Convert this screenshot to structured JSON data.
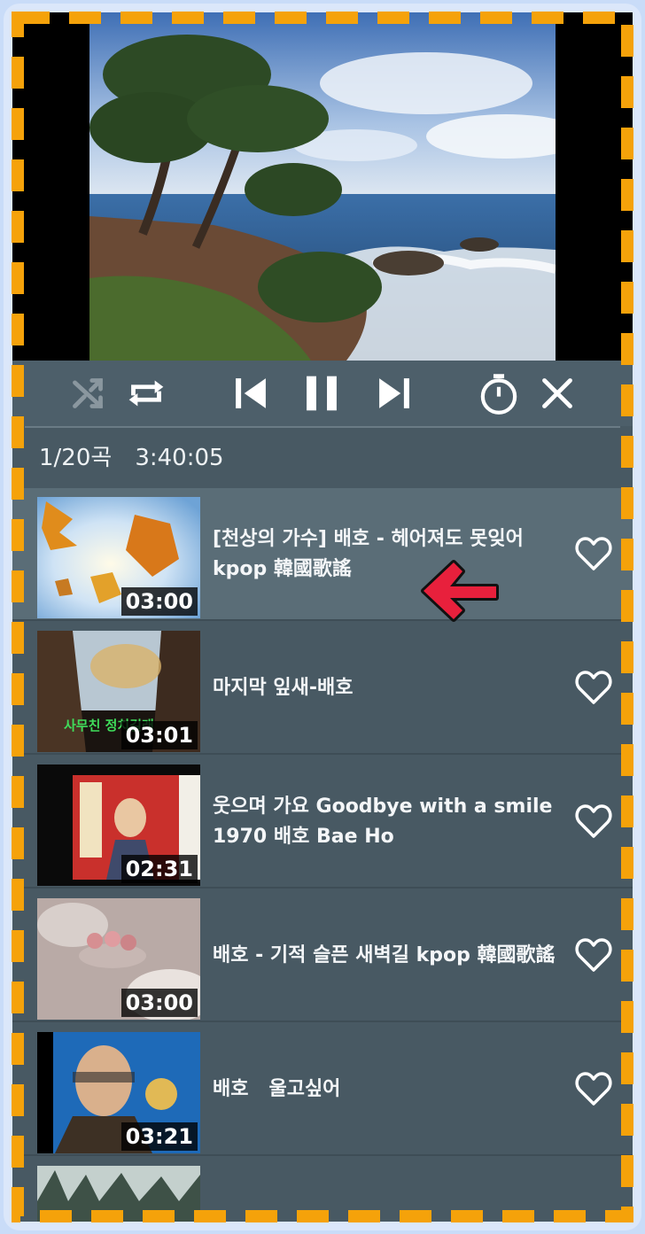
{
  "player": {
    "summary": {
      "track_count": "1/20곡",
      "total_time": "3:40:05"
    },
    "icons": {
      "shuffle": "shuffle-icon",
      "repeat": "repeat-icon",
      "previous": "skip-previous-icon",
      "pause": "pause-icon",
      "next": "skip-next-icon",
      "timer": "stopwatch-icon",
      "close": "close-icon",
      "favorite": "heart-outline-icon"
    },
    "colors": {
      "panel": "#485963",
      "controls": "#4d5f6a",
      "active_row": "#5a6d77",
      "annotation_arrow": "#e8203c",
      "frame_dash": "#f5a20a"
    }
  },
  "playlist": [
    {
      "title": "[천상의 가수] 배호 - 헤어져도 못잊어 kpop 韓國歌謠",
      "duration": "03:00",
      "active": true
    },
    {
      "title": "마지막 잎새-배호",
      "duration": "03:01",
      "thumb_caption": "사무친 정치길래"
    },
    {
      "title": "웃으며 가요 Goodbye with a smile 1970 배호 Bae Ho",
      "duration": "02:31"
    },
    {
      "title": "배호 - 기적 슬픈 새벽길 kpop 韓國歌謠",
      "duration": "03:00"
    },
    {
      "title": "배호   울고싶어",
      "duration": "03:21"
    }
  ]
}
